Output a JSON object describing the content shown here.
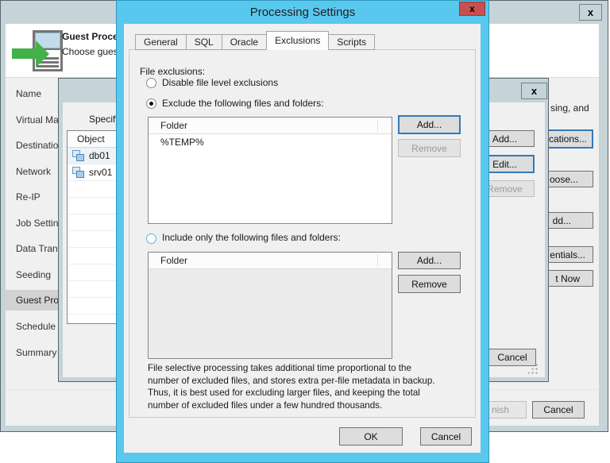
{
  "colors": {
    "accent_cyan": "#58c8ef",
    "titlebar_gray": "#c6d4d9",
    "close_red": "#c75050",
    "focus_blue": "#3579b8"
  },
  "wizard": {
    "close_glyph": "x",
    "header": {
      "title_fragment": "Guest Proce",
      "subtitle_fragment": "Choose gues"
    },
    "steps": [
      {
        "label": "Name"
      },
      {
        "label": "Virtual Ma"
      },
      {
        "label": "Destinatio"
      },
      {
        "label": "Network"
      },
      {
        "label": "Re-IP"
      },
      {
        "label": "Job Settin"
      },
      {
        "label": "Data Tran"
      },
      {
        "label": "Seeding"
      },
      {
        "label": "Guest Pro",
        "active": true
      },
      {
        "label": "Schedule"
      },
      {
        "label": "Summary"
      }
    ],
    "content_text_fragment": "sing, and",
    "buttons": {
      "applications_fragment": "cations...",
      "choose_fragment": "oose...",
      "add_fragment": "dd...",
      "credentials_fragment": "entials...",
      "test_now_fragment": "t Now"
    },
    "finish_fragment": "nish",
    "cancel_label": "Cancel"
  },
  "middle_dialog": {
    "close_glyph": "x",
    "instruction_fragment": "Specify a",
    "list": {
      "header": "Object",
      "rows": [
        {
          "name": "db01"
        },
        {
          "name": "srv01"
        }
      ]
    },
    "add_label": "Add...",
    "edit_label": "Edit...",
    "remove_label": "Remove",
    "cancel_label": "Cancel"
  },
  "front_dialog": {
    "title": "Processing Settings",
    "close_glyph": "x",
    "tabs": [
      {
        "label": "General"
      },
      {
        "label": "SQL"
      },
      {
        "label": "Oracle"
      },
      {
        "label": "Exclusions",
        "active": true
      },
      {
        "label": "Scripts"
      }
    ],
    "section_label": "File exclusions:",
    "radio_disable": {
      "label": "Disable file level exclusions",
      "selected": false
    },
    "radio_exclude": {
      "label": "Exclude the following files and folders:",
      "selected": true
    },
    "exclude_list": {
      "header": "Folder",
      "rows": [
        {
          "folder": "%TEMP%"
        }
      ],
      "add_label": "Add...",
      "remove_label": "Remove"
    },
    "radio_include": {
      "label": "Include only the following files and folders:",
      "selected": false
    },
    "include_list": {
      "header": "Folder",
      "rows": [],
      "add_label": "Add...",
      "remove_label": "Remove"
    },
    "note_lines": [
      "File selective processing takes additional time proportional to the",
      "number of excluded files, and stores extra per-file metadata in backup.",
      "Thus, it is best used for excluding larger files, and keeping the total",
      "number of excluded files under a few hundred thousands."
    ],
    "ok_label": "OK",
    "cancel_label": "Cancel"
  }
}
